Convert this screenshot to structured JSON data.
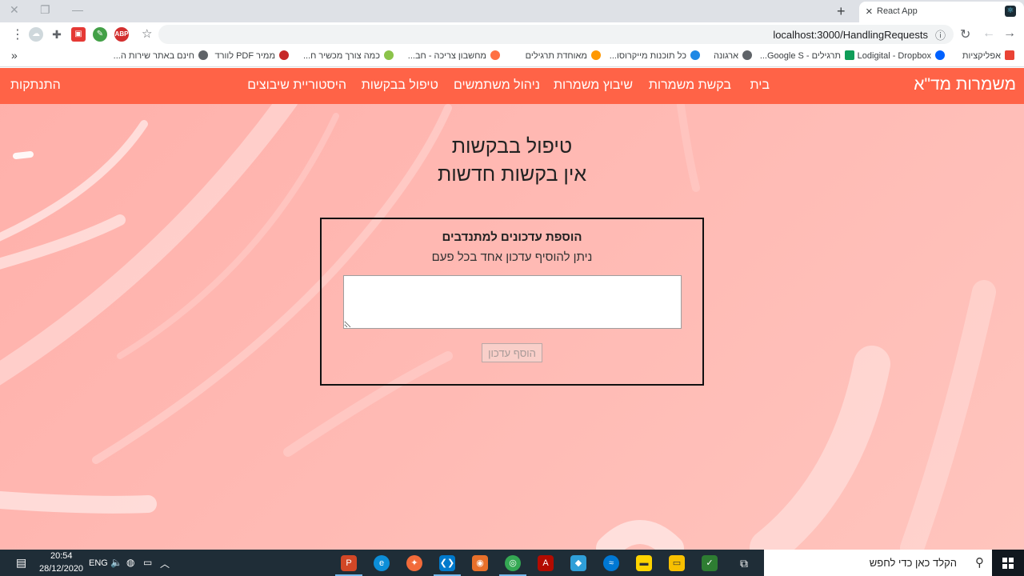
{
  "browser": {
    "tab_title": "React App",
    "url": "localhost:3000/HandlingRequests",
    "bookmarks": [
      {
        "label": "אפליקציות",
        "color": "#ea4335"
      },
      {
        "label": "Lodigital - Dropbox",
        "color": "#0061ff"
      },
      {
        "label": "תרגילים - Google S...",
        "color": "#0f9d58"
      },
      {
        "label": "ארגונה",
        "color": "#5f6368"
      },
      {
        "label": "כל תוכנות מייקרוסו...",
        "color": "#1e88e5"
      },
      {
        "label": "מאוחדת תרגילים",
        "color": "#5f6368"
      },
      {
        "label": "מחשבון צריכה - חב...",
        "color": "#ff9800"
      },
      {
        "label": "כמה צורך מכשיר ח...",
        "color": "#8bc34a"
      },
      {
        "label": "ממיר PDF לוורד",
        "color": "#c62828"
      },
      {
        "label": "חינם באתר שירות ה...",
        "color": "#5f6368"
      }
    ],
    "more_bookmarks": "»"
  },
  "navbar": {
    "brand": "משמרות מד\"א",
    "links": [
      "בית",
      "בקשת משמרות",
      "שיבוץ משמרות",
      "ניהול משתמשים",
      "טיפול בבקשות",
      "היסטוריית שיבוצים"
    ],
    "logout": "התנתקות"
  },
  "page": {
    "title": "טיפול בבקשות",
    "subtitle": "אין בקשות חדשות"
  },
  "updates_card": {
    "title": "הוספת עדכונים למתנדבים",
    "hint": "ניתן להוסיף עדכון אחד בכל פעם",
    "textarea_value": "",
    "button_label": "הוסף עדכון"
  },
  "taskbar": {
    "search_placeholder": "הקלד כאן כדי לחפש",
    "time": "20:54",
    "date": "28/12/2020",
    "language": "ENG"
  },
  "colors": {
    "navbar": "#ff6347",
    "background": "#ffb9b3"
  }
}
